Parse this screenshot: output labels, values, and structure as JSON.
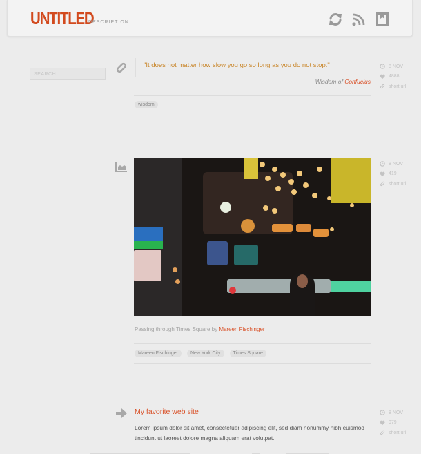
{
  "header": {
    "logo": "UNTITLED",
    "description": "DESCRIPTION",
    "icons": [
      "reblog-icon",
      "rss-icon",
      "bookmark-icon"
    ]
  },
  "sidebar": {
    "search_placeholder": "SEARCH..."
  },
  "colors": {
    "accent": "#d24a1e",
    "quote": "#c9862a",
    "link": "#d9532b",
    "meta": "#c3c3c3"
  },
  "posts": [
    {
      "type": "quote",
      "type_icon": "pencil-icon",
      "quote": "\"It does not matter how slow you go so long as you do not stop.\"",
      "source_prefix": "Wisdom of",
      "source_link": "Confucius",
      "tags": [
        "wisdom"
      ],
      "meta": {
        "date": "8 NOV",
        "likes": "4888",
        "short_url": "short url"
      }
    },
    {
      "type": "photo",
      "type_icon": "photo-icon",
      "caption_prefix": "Passing through Times Square by",
      "caption_link": "Mareen Fischinger",
      "tags": [
        "Mareen Fischinger",
        "New York City",
        "Times Square"
      ],
      "meta": {
        "date": "8 NOV",
        "likes": "419",
        "short_url": "short url"
      }
    },
    {
      "type": "link",
      "type_icon": "arrow-right-icon",
      "title": "My favorite web site",
      "body": "Lorem ipsum dolor sit amet, consectetuer adipiscing elit, sed diam nonummy nibh euismod tincidunt ut laoreet dolore magna aliquam erat volutpat.",
      "meta": {
        "date": "8 NOV",
        "likes": "979",
        "short_url": "short url"
      }
    }
  ]
}
